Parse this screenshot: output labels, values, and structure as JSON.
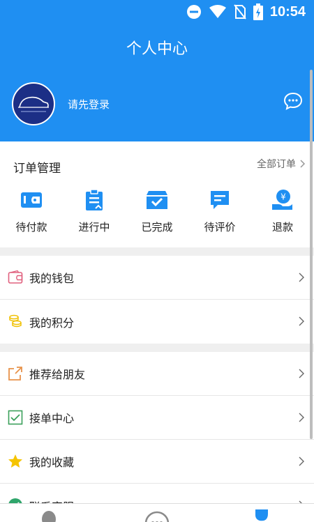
{
  "status": {
    "time": "10:54"
  },
  "header": {
    "title": "个人中心",
    "login_prompt": "请先登录",
    "avatar_alt": "logo-car"
  },
  "orders": {
    "title": "订单管理",
    "all_label": "全部订单",
    "items": [
      {
        "label": "待付款",
        "icon": "wallet-icon"
      },
      {
        "label": "进行中",
        "icon": "clipboard-icon"
      },
      {
        "label": "已完成",
        "icon": "box-check-icon"
      },
      {
        "label": "待评价",
        "icon": "comment-icon"
      },
      {
        "label": "退款",
        "icon": "refund-icon"
      }
    ]
  },
  "group1": [
    {
      "label": "我的钱包",
      "icon": "wallet-outline-icon"
    },
    {
      "label": "我的积分",
      "icon": "coins-icon"
    }
  ],
  "group2": [
    {
      "label": "推荐给朋友",
      "icon": "share-icon"
    },
    {
      "label": "接单中心",
      "icon": "checkbox-icon"
    },
    {
      "label": "我的收藏",
      "icon": "star-icon"
    },
    {
      "label": "联系客服",
      "icon": "service-icon"
    }
  ],
  "colors": {
    "primary": "#1f8ff2"
  }
}
